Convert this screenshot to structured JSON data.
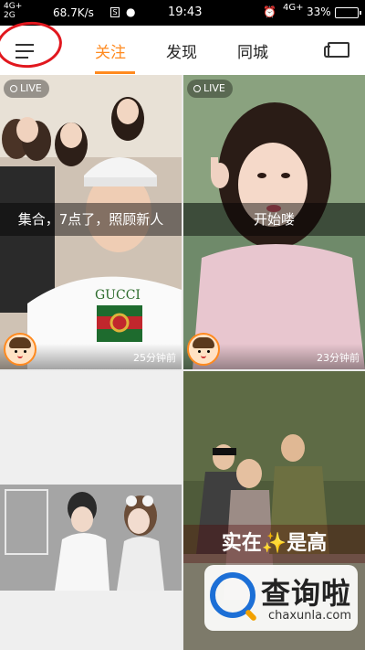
{
  "status_bar": {
    "network_left": "4G+",
    "network_left2": "2G",
    "speed": "68.7K/s",
    "s_badge": "S",
    "time": "19:43",
    "network_right": "4G+",
    "battery": "33%"
  },
  "nav": {
    "tabs": [
      {
        "label": "关注",
        "active": true
      },
      {
        "label": "发现",
        "active": false
      },
      {
        "label": "同城",
        "active": false
      }
    ]
  },
  "feed": [
    {
      "live": "LIVE",
      "caption": "集合，7点了，照顾新人",
      "time_ago": "25分钟前"
    },
    {
      "live": "LIVE",
      "caption": "开始喽",
      "time_ago": "23分钟前"
    },
    {
      "caption": ""
    },
    {
      "caption": "实在✨是高"
    }
  ],
  "watermark": {
    "title": "查询啦",
    "domain": "chaxunla.com"
  },
  "colors": {
    "accent": "#ff8a1f",
    "highlight_circle": "#e1171e"
  }
}
